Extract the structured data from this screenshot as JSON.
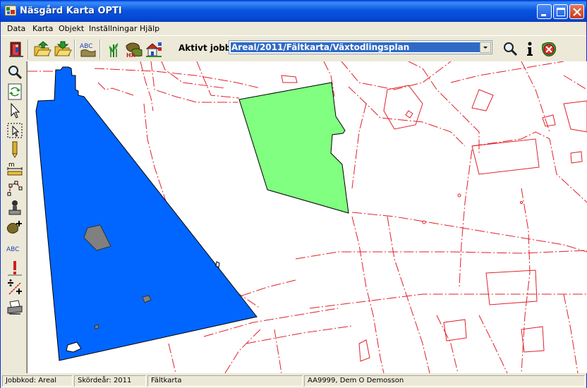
{
  "window": {
    "title": "Näsgård Karta OPTI"
  },
  "menu": [
    "Data",
    "Karta",
    "Objekt",
    "Inställningar",
    "Hjälp"
  ],
  "toolbar": {
    "job_label": "Aktivt jobb",
    "job_value": "Areal/2011/Fältkarta/Växtodlingsplan",
    "abc_label": "ABC",
    "ha_label": "HA"
  },
  "left_tools": {
    "abc_label": "ABC",
    "measure_label": "m"
  },
  "status": {
    "job_code": "Jobbkod: Areal",
    "harvest_year": "Skördeår: 2011",
    "map_type": "Fältkarta",
    "user": "AA9999, Dem O Demosson"
  },
  "colors": {
    "field_blue": "#0066ff",
    "field_green": "#80ff80",
    "boundary_red": "#e0202a",
    "titlebar_blue": "#0a3bb4"
  }
}
